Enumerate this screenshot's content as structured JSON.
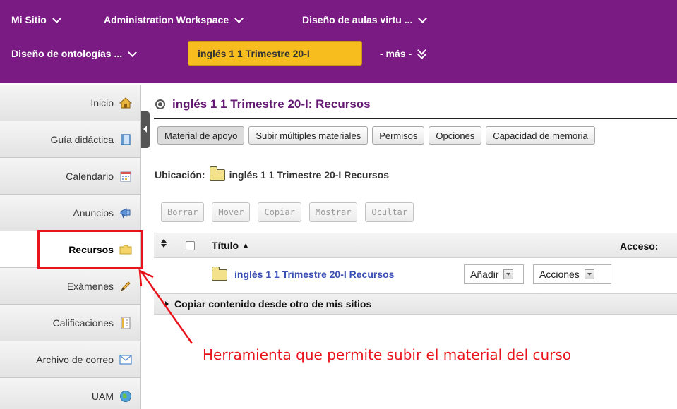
{
  "topnav": {
    "items": [
      {
        "label": "Mi Sitio"
      },
      {
        "label": "Administration Workspace"
      },
      {
        "label": "Diseño de aulas virtu ..."
      },
      {
        "label": "Diseño de ontologías ..."
      }
    ],
    "current": "inglés 1 1 Trimestre 20-I",
    "more": "- más -"
  },
  "sidebar": {
    "items": [
      {
        "label": "Inicio",
        "icon": "home-icon"
      },
      {
        "label": "Guía didáctica",
        "icon": "book-icon"
      },
      {
        "label": "Calendario",
        "icon": "calendar-icon"
      },
      {
        "label": "Anuncios",
        "icon": "megaphone-icon"
      },
      {
        "label": "Recursos",
        "icon": "folder-icon",
        "active": true
      },
      {
        "label": "Exámenes",
        "icon": "pencil-icon"
      },
      {
        "label": "Calificaciones",
        "icon": "gradebook-icon"
      },
      {
        "label": "Archivo de correo",
        "icon": "mail-icon"
      },
      {
        "label": "UAM",
        "icon": "globe-icon"
      }
    ]
  },
  "main": {
    "title": "inglés 1 1 Trimestre 20-I: Recursos",
    "tabs": [
      {
        "label": "Material de apoyo"
      },
      {
        "label": "Subir múltiples materiales"
      },
      {
        "label": "Permisos"
      },
      {
        "label": "Opciones"
      },
      {
        "label": "Capacidad de memoria"
      }
    ],
    "location_label": "Ubicación:",
    "location_value": "inglés 1 1 Trimestre 20-I Recursos",
    "actions": [
      {
        "label": "Borrar"
      },
      {
        "label": "Mover"
      },
      {
        "label": "Copiar"
      },
      {
        "label": "Mostrar"
      },
      {
        "label": "Ocultar"
      }
    ],
    "columns": {
      "title": "Título",
      "access": "Acceso:"
    },
    "rows": [
      {
        "name": "inglés 1 1 Trimestre 20-I Recursos",
        "add": "Añadir",
        "actions": "Acciones"
      }
    ],
    "copy_content": "Copiar contenido desde otro de mis sitios"
  },
  "annotation": {
    "text": "Herramienta que permite subir el material del curso",
    "color": "#e8131b"
  },
  "colors": {
    "nav_bg": "#7a1a83",
    "current_site": "#f7bd1f",
    "title": "#651873",
    "link": "#3a4fb5"
  }
}
